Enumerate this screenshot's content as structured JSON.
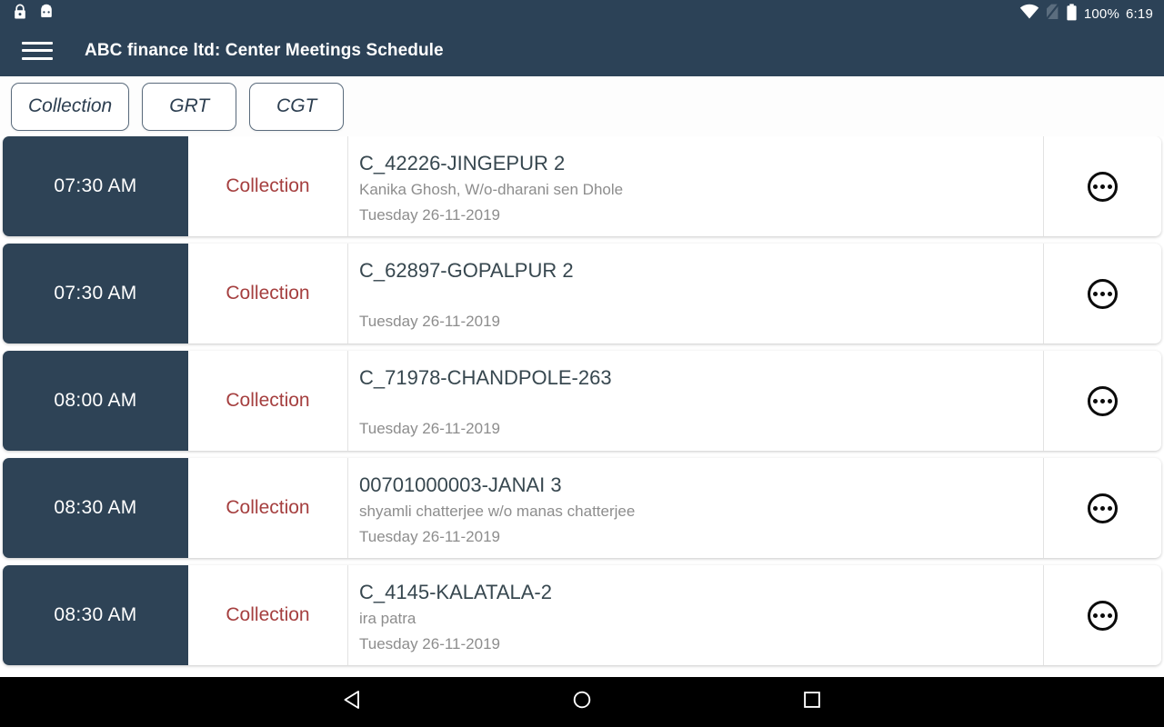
{
  "status_bar": {
    "left_icons": [
      "lock-icon",
      "android-robot-icon"
    ],
    "right_icons": [
      "wifi-icon",
      "no-sim-icon",
      "battery-icon"
    ],
    "battery_percent": "100%",
    "clock": "6:19"
  },
  "app_bar": {
    "menu_icon": "hamburger-menu-icon",
    "title": "ABC finance ltd: Center Meetings Schedule"
  },
  "tabs": {
    "ghost_label": "",
    "items": [
      {
        "label": "Collection",
        "selected": true
      },
      {
        "label": "GRT",
        "selected": false
      },
      {
        "label": "CGT",
        "selected": false
      }
    ]
  },
  "meetings": [
    {
      "time": "07:30 AM",
      "type": "Collection",
      "center": "C_42226-JINGEPUR 2",
      "contact": "Kanika Ghosh, W/o-dharani  sen Dhole",
      "date": "Tuesday 26-11-2019",
      "action_icon": "overflow-menu-icon"
    },
    {
      "time": "07:30 AM",
      "type": "Collection",
      "center": "C_62897-GOPALPUR 2",
      "contact": "",
      "date": "Tuesday 26-11-2019",
      "action_icon": "overflow-menu-icon"
    },
    {
      "time": "08:00 AM",
      "type": "Collection",
      "center": "C_71978-CHANDPOLE-263",
      "contact": "",
      "date": "Tuesday 26-11-2019",
      "action_icon": "overflow-menu-icon"
    },
    {
      "time": "08:30 AM",
      "type": "Collection",
      "center": "00701000003-JANAI 3",
      "contact": "shyamli chatterjee w/o manas chatterjee",
      "date": "Tuesday 26-11-2019",
      "action_icon": "overflow-menu-icon"
    },
    {
      "time": "08:30 AM",
      "type": "Collection",
      "center": "C_4145-KALATALA-2",
      "contact": "ira patra",
      "date": "Tuesday 26-11-2019",
      "action_icon": "overflow-menu-icon"
    }
  ],
  "nav_bar": {
    "back_icon": "back-triangle-icon",
    "home_icon": "home-circle-icon",
    "recents_icon": "recents-square-icon"
  },
  "colors": {
    "header_navy": "#2c4257",
    "time_block_navy": "#2e4356",
    "accent_red": "#a53f3f",
    "muted_gray": "#8d8d8d",
    "title_gray": "#37474f",
    "nav_black": "#000000"
  }
}
